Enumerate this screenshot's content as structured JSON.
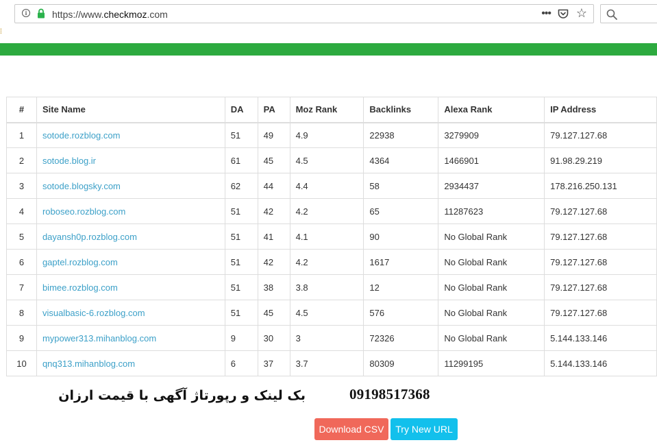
{
  "browser": {
    "url_prefix": "https://www.",
    "url_host": "checkmoz",
    "url_suffix": ".com",
    "icons": [
      "info-icon",
      "lock-icon",
      "more-icon",
      "pocket-icon",
      "star-icon",
      "search-icon"
    ]
  },
  "accent_colors": {
    "bar": "#2daa3f",
    "link": "#3ca0c8",
    "csv_button": "#f0685a",
    "new_url_button": "#12c0ec"
  },
  "table": {
    "headers": [
      "#",
      "Site Name",
      "DA",
      "PA",
      "Moz Rank",
      "Backlinks",
      "Alexa Rank",
      "IP Address"
    ],
    "rows": [
      [
        "1",
        "sotode.rozblog.com",
        "51",
        "49",
        "4.9",
        "22938",
        "3279909",
        "79.127.127.68"
      ],
      [
        "2",
        "sotode.blog.ir",
        "61",
        "45",
        "4.5",
        "4364",
        "1466901",
        "91.98.29.219"
      ],
      [
        "3",
        "sotode.blogsky.com",
        "62",
        "44",
        "4.4",
        "58",
        "2934437",
        "178.216.250.131"
      ],
      [
        "4",
        "roboseo.rozblog.com",
        "51",
        "42",
        "4.2",
        "65",
        "11287623",
        "79.127.127.68"
      ],
      [
        "5",
        "dayansh0p.rozblog.com",
        "51",
        "41",
        "4.1",
        "90",
        "No Global Rank",
        "79.127.127.68"
      ],
      [
        "6",
        "gaptel.rozblog.com",
        "51",
        "42",
        "4.2",
        "1617",
        "No Global Rank",
        "79.127.127.68"
      ],
      [
        "7",
        "bimee.rozblog.com",
        "51",
        "38",
        "3.8",
        "12",
        "No Global Rank",
        "79.127.127.68"
      ],
      [
        "8",
        "visualbasic-6.rozblog.com",
        "51",
        "45",
        "4.5",
        "576",
        "No Global Rank",
        "79.127.127.68"
      ],
      [
        "9",
        "mypower313.mihanblog.com",
        "9",
        "30",
        "3",
        "72326",
        "No Global Rank",
        "5.144.133.146"
      ],
      [
        "10",
        "qnq313.mihanblog.com",
        "6",
        "37",
        "3.7",
        "80309",
        "11299195",
        "5.144.133.146"
      ]
    ]
  },
  "overlay": {
    "phone": "09198517368",
    "promo": "بک لینک و رپورتاژ آگهی با قیمت ارزان"
  },
  "actions": {
    "download_csv": "Download CSV",
    "try_new_url": "Try New URL"
  }
}
